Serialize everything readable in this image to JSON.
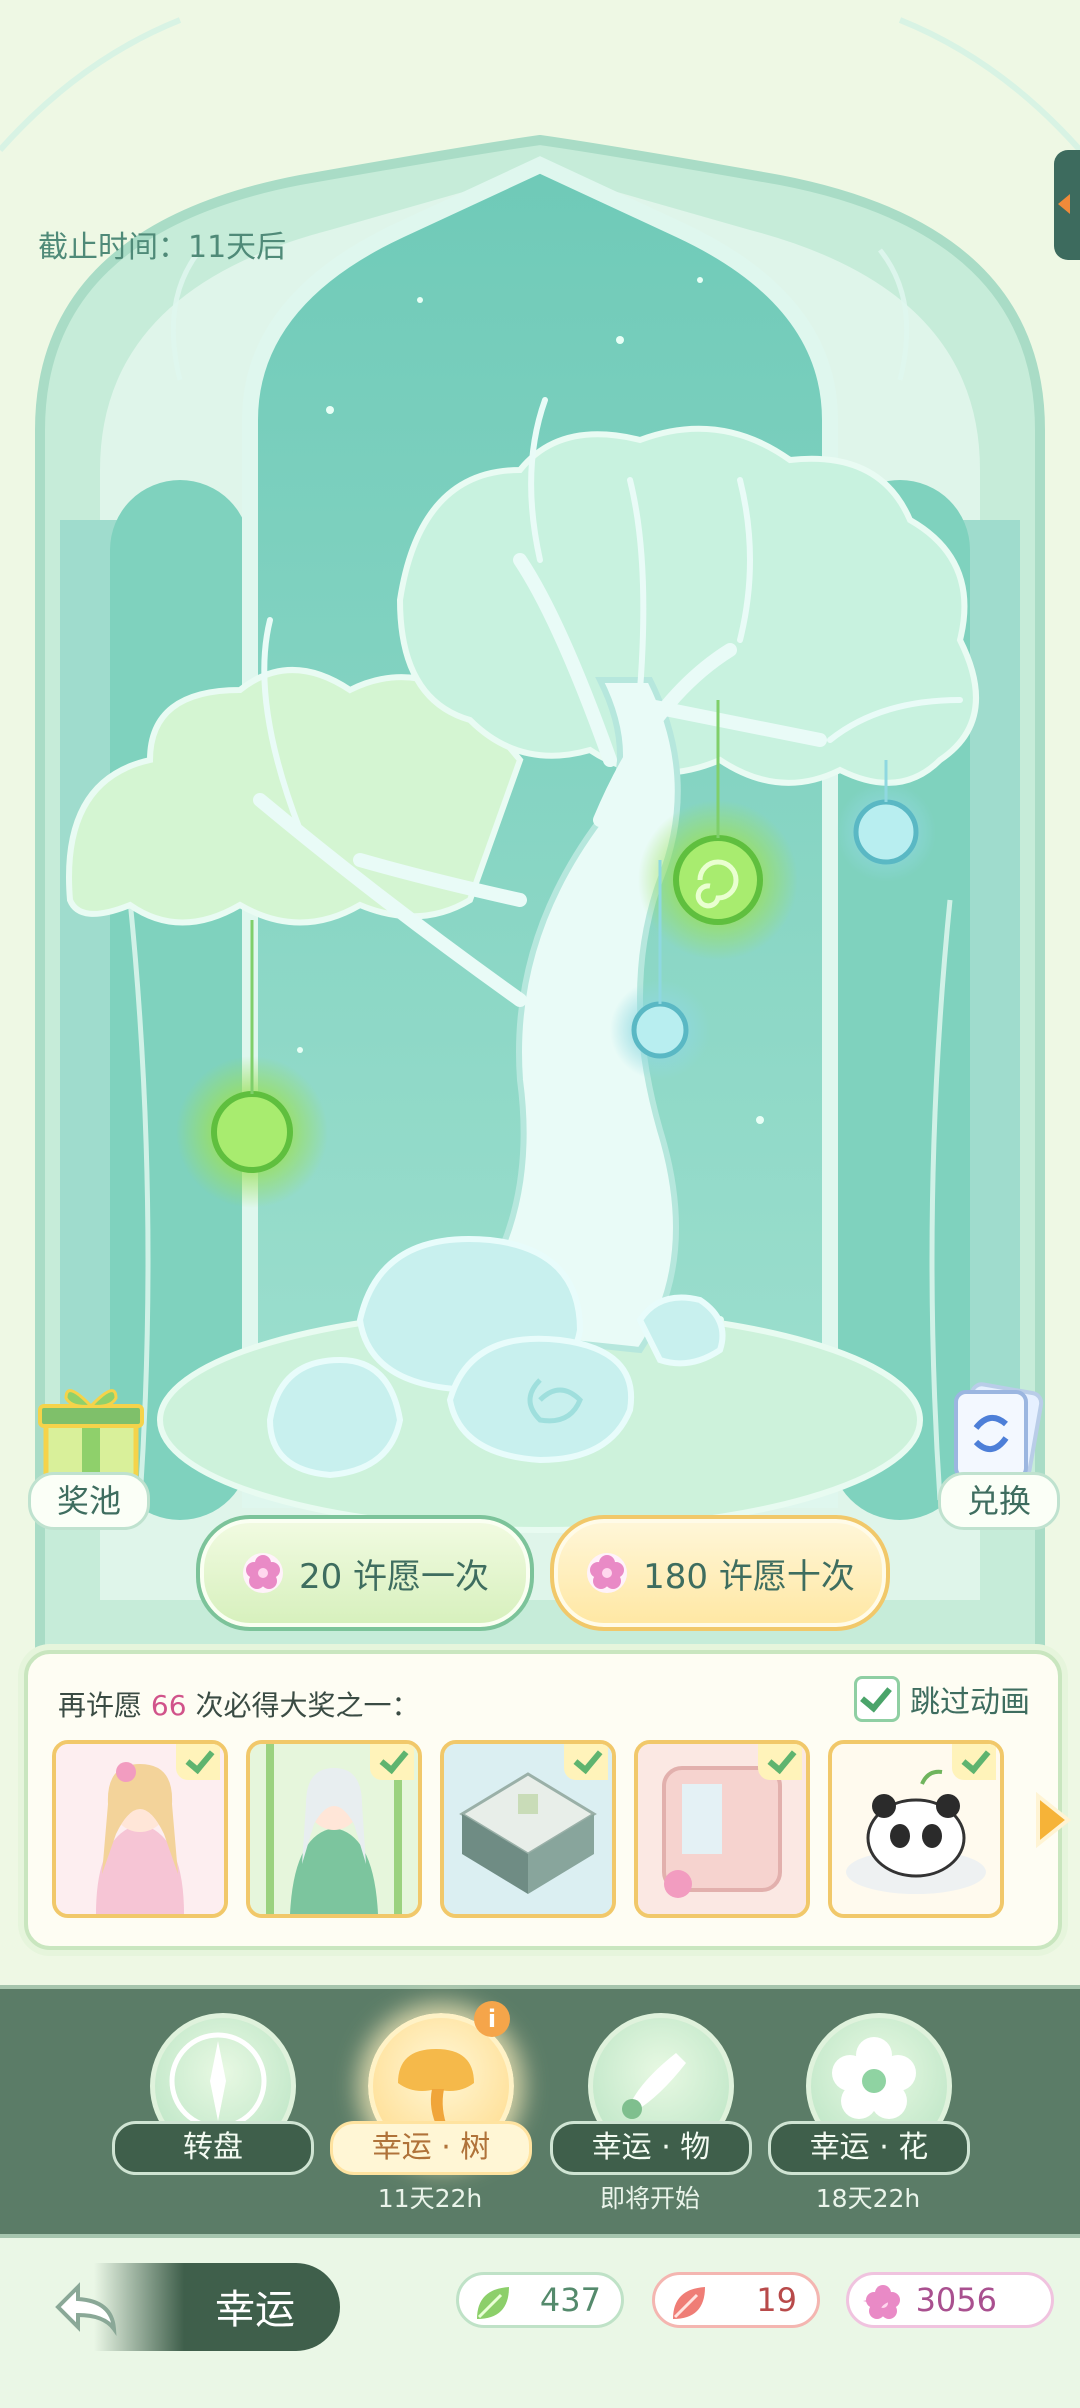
{
  "header": {
    "deadline": "截止时间：11天后"
  },
  "side_buttons": {
    "pool": "奖池",
    "exchange": "兑换"
  },
  "wish_buttons": {
    "one": {
      "cost": "20",
      "label": "许愿一次"
    },
    "ten": {
      "cost": "180",
      "label": "许愿十次"
    }
  },
  "prize_panel": {
    "pity_prefix": "再许愿",
    "pity_count": "66",
    "pity_suffix": "次必得大奖之一：",
    "skip_animation": "跳过动画",
    "skip_checked": true,
    "prizes": [
      "outfit-pink-princess",
      "outfit-bamboo-fairy",
      "garden-pavilion",
      "pink-room",
      "panda-cloud"
    ]
  },
  "modes": [
    {
      "label": "转盘",
      "sub": "",
      "icon": "compass-icon"
    },
    {
      "label": "幸运 · 树",
      "sub": "11天22h",
      "icon": "golden-tree-icon"
    },
    {
      "label": "幸运 · 物",
      "sub": "即将开始",
      "icon": "brush-icon"
    },
    {
      "label": "幸运 · 花",
      "sub": "18天22h",
      "icon": "flower-icon"
    }
  ],
  "footer": {
    "back_label": "幸运",
    "currency": {
      "leaf": "437",
      "petal": "19",
      "star": "3056"
    }
  },
  "colors": {
    "accent": "#5b7c67",
    "wish_one": "#d6f0bc",
    "wish_ten": "#ffe7a2",
    "pity_highlight": "#d1538a"
  }
}
